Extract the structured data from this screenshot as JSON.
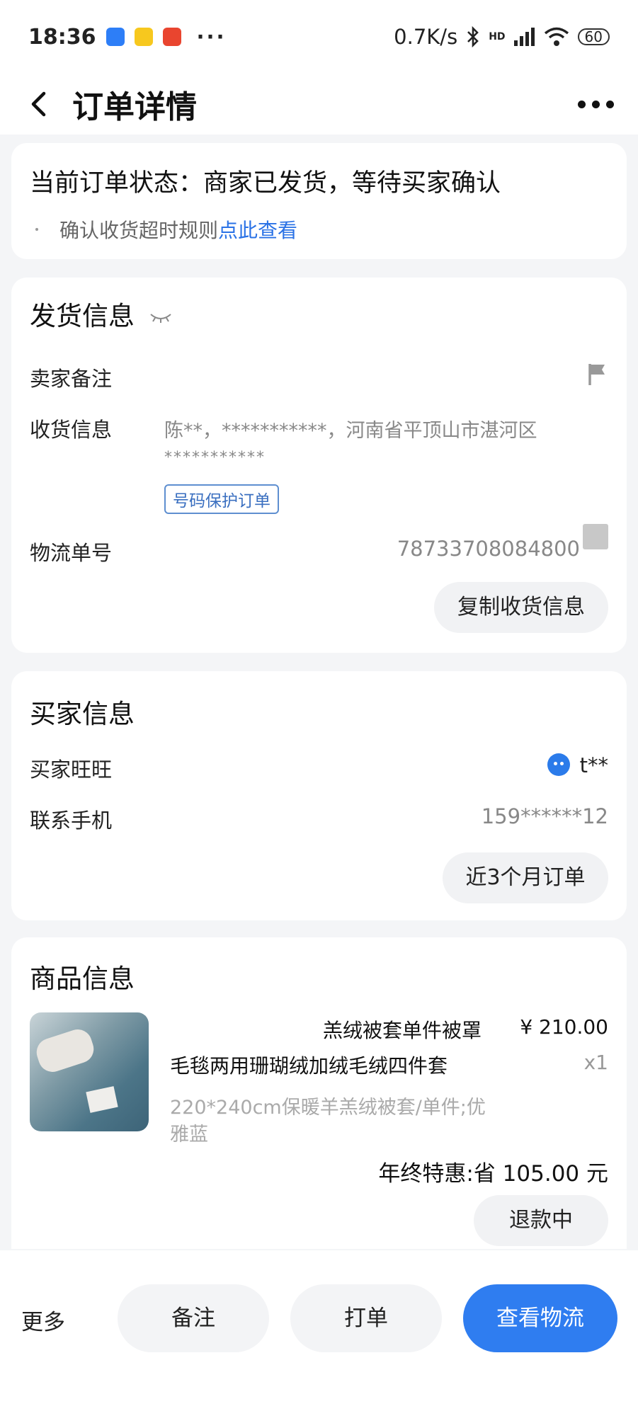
{
  "status_bar": {
    "time": "18:36",
    "more": "···",
    "net_speed": "0.7K/s",
    "network_badge": "HD",
    "battery": "60"
  },
  "header": {
    "title": "订单详情"
  },
  "order_status": {
    "title": "当前订单状态：商家已发货，等待买家确认",
    "rule_text": "确认收货超时规则",
    "rule_link": "点此查看"
  },
  "shipping": {
    "title": "发货信息",
    "seller_note_label": "卖家备注",
    "receiver_label": "收货信息",
    "receiver_line1": "陈**，***********，河南省平顶山市湛河区",
    "receiver_line2": "***********",
    "protect_tag": "号码保护订单",
    "tracking_label": "物流单号",
    "tracking_number": "78733708084800",
    "copy_button": "复制收货信息"
  },
  "buyer": {
    "title": "买家信息",
    "wangwang_label": "买家旺旺",
    "wangwang_value": "t**",
    "phone_label": "联系手机",
    "phone_value": "159******12",
    "recent_orders_button": "近3个月订单"
  },
  "product": {
    "title": "商品信息",
    "name_line1": "羔绒被套单件被罩",
    "name_line2": "毛毯两用珊瑚绒加绒毛绒四件套",
    "price": "¥ 210.00",
    "quantity": "x1",
    "sku_line1": "220*240cm保暖羊羔绒被套/单件;优",
    "sku_line2": "雅蓝",
    "discount": "年终特惠:省 105.00 元",
    "refund_status": "退款中"
  },
  "bottom_bar": {
    "more": "更多",
    "note": "备注",
    "print": "打单",
    "logistics": "查看物流"
  },
  "colors": {
    "accent": "#2f7df0",
    "link": "#2a72e6",
    "background": "#f4f5f7"
  }
}
